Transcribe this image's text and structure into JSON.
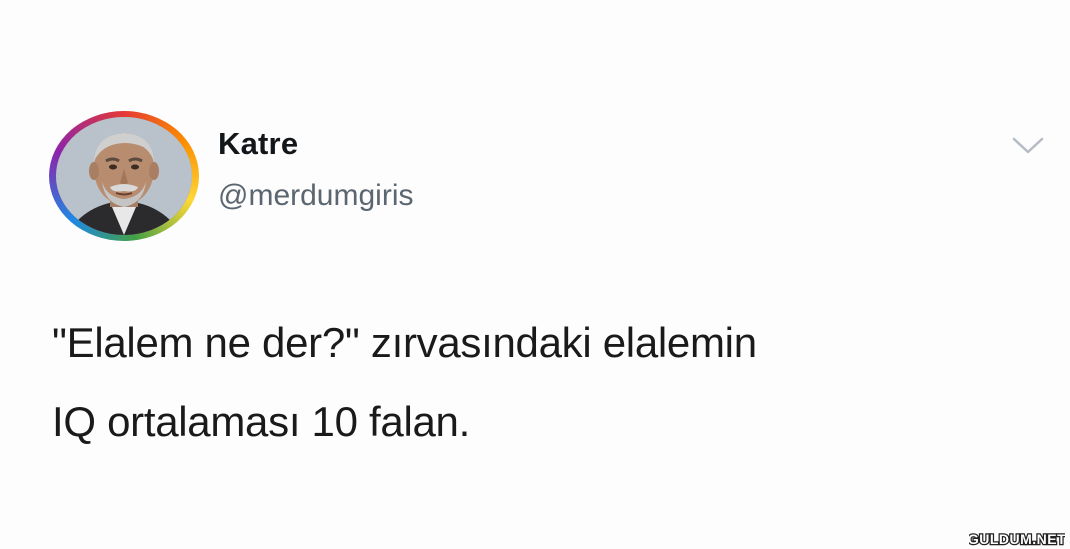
{
  "tweet": {
    "author": {
      "display_name": "Katre",
      "handle": "@merdumgiris",
      "avatar_icon": "profile-photo"
    },
    "menu_icon": "chevron-down-icon",
    "text_lines": [
      "\"Elalem ne der?\" zırvasındaki elalemin",
      "IQ ortalaması 10 falan."
    ]
  },
  "watermark": {
    "text": "GULDUM.NET"
  },
  "colors": {
    "background": "#fdfdfd",
    "text": "#14171a",
    "handle": "#5b6670",
    "caret": "#b5bcc3"
  }
}
